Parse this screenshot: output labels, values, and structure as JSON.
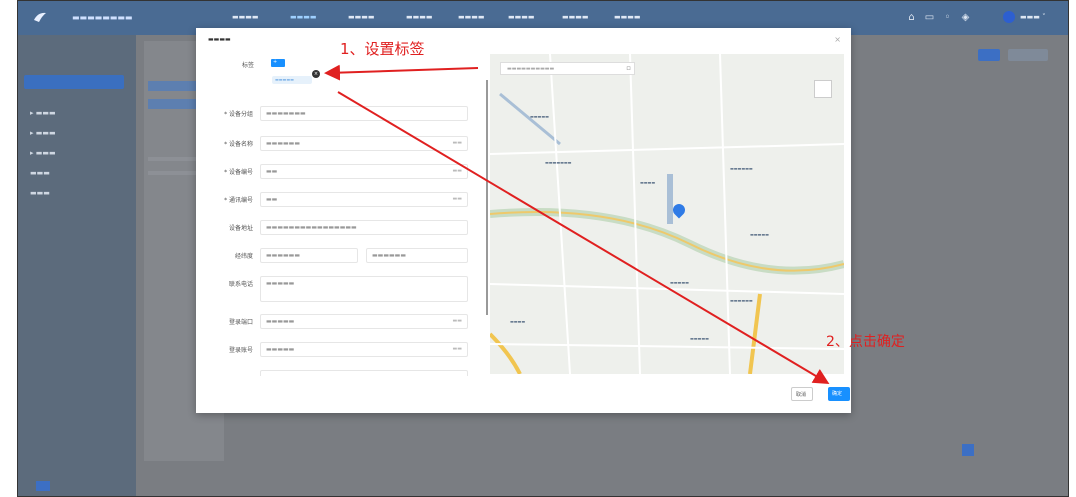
{
  "annotations": {
    "step1": "1、设置标签",
    "step2": "2、点击确定"
  },
  "form": {
    "tag_label": "标签",
    "fields": [
      {
        "label": "* 设备分组"
      },
      {
        "label": "* 设备名称"
      },
      {
        "label": "* 设备编号"
      },
      {
        "label": "* 通讯编号"
      },
      {
        "label": "设备地址"
      },
      {
        "label": "经纬度"
      },
      {
        "label": "联系电话"
      },
      {
        "label": "登录端口"
      },
      {
        "label": "登录账号"
      }
    ]
  },
  "buttons": {
    "cancel": "取消",
    "confirm": "确定"
  },
  "colors": {
    "annotation": "#e02020",
    "primary": "#1890ff",
    "nav": "#4a6b93"
  }
}
